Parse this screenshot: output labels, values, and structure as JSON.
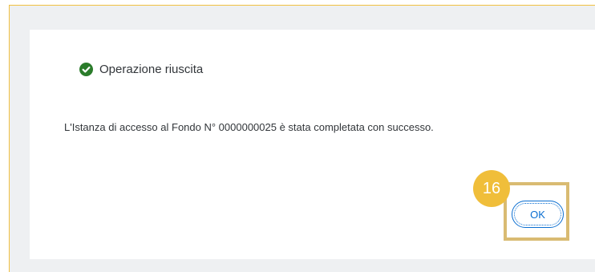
{
  "dialog": {
    "title": "Operazione riuscita",
    "message": "L'Istanza di accesso al Fondo N° 0000000025 è stata completata con successo.",
    "ok_label": "OK",
    "status_icon": "success-check-icon"
  },
  "annotation": {
    "step_number": "16"
  },
  "colors": {
    "success": "#2b7c2b",
    "accent": "#0a6ed1",
    "highlight": "#d9bb72",
    "badge": "#f0be3a"
  }
}
